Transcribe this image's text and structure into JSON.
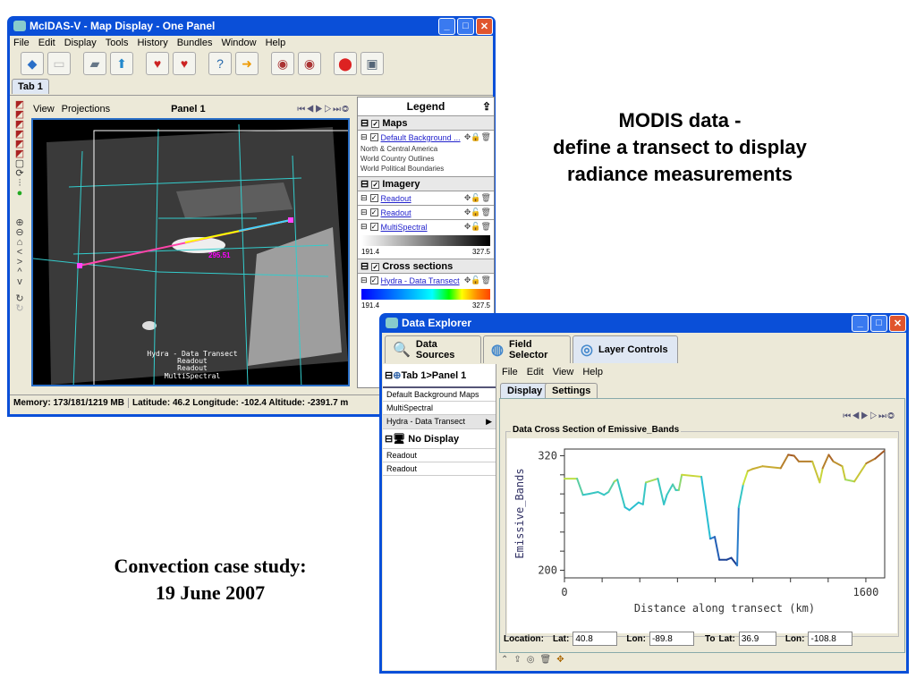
{
  "slide": {
    "heading_lines": [
      "MODIS data -",
      "define a transect to display",
      "radiance measurements"
    ],
    "caption_lines": [
      "Convection case study:",
      "19 June 2007"
    ]
  },
  "map_window": {
    "title": "McIDAS-V - Map Display - One Panel",
    "menu": [
      "File",
      "Edit",
      "Display",
      "Tools",
      "History",
      "Bundles",
      "Window",
      "Help"
    ],
    "tab": "Tab 1",
    "panel_menu": [
      "View",
      "Projections"
    ],
    "panel_title": "Panel 1",
    "map_labels": [
      "Hydra - Data Transect",
      "Readout",
      "Readout",
      "MultiSpectral"
    ],
    "readout_value": "295.51",
    "legend": {
      "title": "Legend",
      "maps": {
        "label": "Maps",
        "layer": "Default Background ...",
        "items": [
          "North & Central America",
          "World Country Outlines",
          "World Political Boundaries"
        ]
      },
      "imagery": {
        "label": "Imagery",
        "layers": [
          "Readout",
          "Readout",
          "MultiSpectral"
        ],
        "min": "191.4",
        "max": "327.5"
      },
      "cross": {
        "label": "Cross sections",
        "layer": "Hydra - Data Transect",
        "min": "191.4",
        "max": "327.5"
      }
    },
    "status": {
      "memory": "Memory: 173/181/1219 MB",
      "position": "Latitude:   46.2 Longitude: -102.4 Altitude: -2391.7 m"
    }
  },
  "explorer": {
    "title": "Data Explorer",
    "tabs": [
      "Data Sources",
      "Field Selector",
      "Layer Controls"
    ],
    "tree": {
      "panel": "Tab 1>Panel 1",
      "items": [
        "Default Background Maps",
        "MultiSpectral",
        "Hydra - Data Transect"
      ],
      "no_display": "No Display",
      "no_display_items": [
        "Readout",
        "Readout"
      ]
    },
    "menu": [
      "File",
      "Edit",
      "View",
      "Help"
    ],
    "subtabs": [
      "Display",
      "Settings"
    ],
    "group_title": "Data Cross Section  of Emissive_Bands",
    "location": {
      "label": "Location:",
      "lat_label": "Lat:",
      "lat": "40.8",
      "lon_label": "Lon:",
      "lon": "-89.8",
      "to_label": "To",
      "to_lat_label": "Lat:",
      "to_lat": "36.9",
      "to_lon_label": "Lon:",
      "to_lon": "-108.8"
    }
  },
  "chart_data": {
    "type": "line",
    "title": "Data Cross Section  of Emissive_Bands",
    "xlabel": "Distance along transect (km)",
    "ylabel": "Emissive_Bands",
    "xlim": [
      0,
      1700
    ],
    "ylim": [
      192,
      327
    ],
    "xticks": [
      0,
      200,
      400,
      600,
      800,
      1000,
      1200,
      1400,
      1600
    ],
    "xtick_labels": [
      "0",
      "1600"
    ],
    "yticks": [
      200,
      220,
      240,
      260,
      280,
      300,
      320
    ],
    "ytick_labels": [
      "200",
      "320"
    ],
    "x": [
      0,
      67,
      98,
      130,
      178,
      210,
      234,
      265,
      281,
      321,
      345,
      393,
      417,
      432,
      496,
      528,
      544,
      575,
      591,
      607,
      623,
      727,
      774,
      798,
      822,
      862,
      886,
      917,
      925,
      949,
      973,
      997,
      1052,
      1148,
      1188,
      1219,
      1244,
      1316,
      1355,
      1371,
      1403,
      1427,
      1475,
      1491,
      1539,
      1602,
      1650,
      1697
    ],
    "y": [
      296,
      296,
      279,
      280,
      282,
      279,
      282,
      293,
      295,
      266,
      263,
      271,
      269,
      292,
      296,
      269,
      279,
      290,
      284,
      284,
      300,
      298,
      233,
      235,
      211,
      211,
      213,
      205,
      266,
      290,
      304,
      306,
      309,
      307,
      321,
      320,
      314,
      314,
      292,
      307,
      321,
      314,
      309,
      295,
      293,
      312,
      317,
      325
    ]
  }
}
